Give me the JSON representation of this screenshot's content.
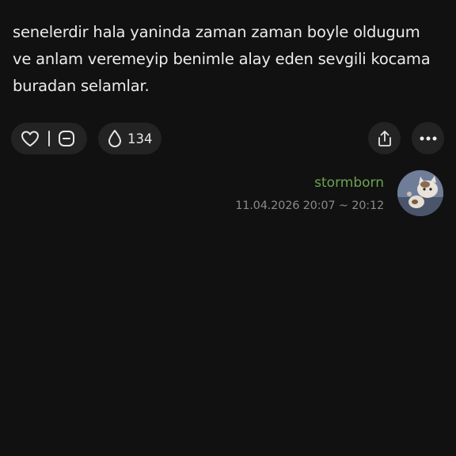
{
  "post": {
    "text": "senelerdir hala yaninda zaman zaman boyle oldugum\nve anlam veremeyip benimle alay eden sevgili kocama\nburadan selamlar."
  },
  "actions": {
    "drop_count": "134",
    "icons": {
      "like": "heart-icon",
      "minus": "minus-box-icon",
      "drop": "drop-icon",
      "share": "share-icon",
      "more": "more-dots-icon"
    }
  },
  "author": {
    "name": "stormborn",
    "time": "11.04.2026 20:07 ~ 20:12",
    "name_color": "#6ea352"
  },
  "colors": {
    "background": "#111111",
    "pill": "#232323",
    "text": "#ececec",
    "muted": "#8a8a8a"
  }
}
